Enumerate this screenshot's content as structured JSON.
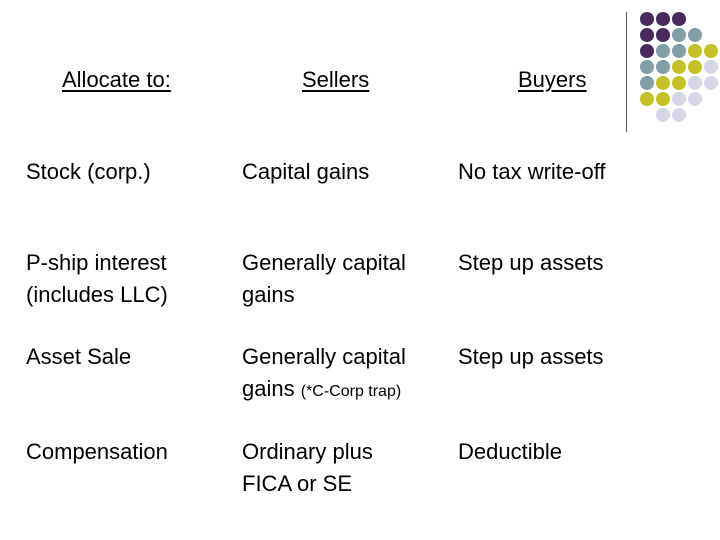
{
  "header": {
    "allocate": "Allocate to:",
    "sellers": "Sellers",
    "buyers": "Buyers"
  },
  "rows": [
    {
      "label": "Stock (corp.)",
      "sellers": "Capital gains",
      "buyers": "No tax write-off"
    },
    {
      "label_l1": "P-ship interest",
      "label_l2": "(includes LLC)",
      "sellers_l1": "Generally capital",
      "sellers_l2": "gains",
      "buyers": "Step up assets"
    },
    {
      "label": "Asset Sale",
      "sellers_l1": "Generally capital",
      "sellers_l2": "gains",
      "sellers_note": "(*C-Corp trap)",
      "buyers": "Step up assets"
    },
    {
      "label": "Compensation",
      "sellers_l1": "Ordinary plus",
      "sellers_l2": "FICA or SE",
      "buyers": "Deductible"
    }
  ],
  "decor_colors": {
    "purple": "#4a2a63",
    "teal": "#7f9ea6",
    "olive": "#c2c12a",
    "lavender": "#d6d6e6"
  }
}
